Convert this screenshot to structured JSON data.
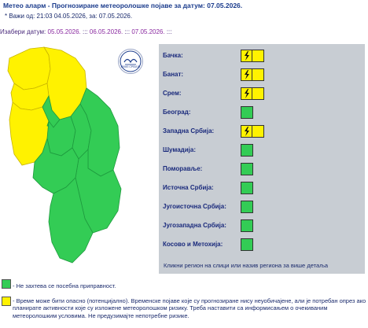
{
  "header": {
    "title": "Метео аларм - Прогнозиране метеоролошке појаве за датум:  07.05.2026.",
    "validity": "* Важи од: 21:03 04.05.2026, за: 07.05.2026."
  },
  "date_selector": {
    "label": "Изабери датум:",
    "dates": [
      "05.05.2026.",
      "06.05.2026.",
      "07.05.2026."
    ],
    "separator": ":::"
  },
  "emblem": {
    "text": "РХМЗ СРБИЈЕ"
  },
  "regions": [
    {
      "name": "Бачка:",
      "level": "yellow",
      "icon": "thunderstorm-icon"
    },
    {
      "name": "Банат:",
      "level": "yellow",
      "icon": "thunderstorm-icon"
    },
    {
      "name": "Срем:",
      "level": "yellow",
      "icon": "thunderstorm-icon"
    },
    {
      "name": "Београд:",
      "level": "green",
      "icon": ""
    },
    {
      "name": "Западна Србија:",
      "level": "yellow",
      "icon": "thunderstorm-icon"
    },
    {
      "name": "Шумадија:",
      "level": "green",
      "icon": ""
    },
    {
      "name": "Поморавље:",
      "level": "green",
      "icon": ""
    },
    {
      "name": "Источна Србија:",
      "level": "green",
      "icon": ""
    },
    {
      "name": "Југоисточна Србија:",
      "level": "green",
      "icon": ""
    },
    {
      "name": "Југозападна Србија:",
      "level": "green",
      "icon": ""
    },
    {
      "name": "Косово и Метохија:",
      "level": "green",
      "icon": ""
    }
  ],
  "panel_hint": "Кликни регион на слици или назив региона за више детаља",
  "legend": {
    "green_text": "- Не захтева се посебна приправност.",
    "yellow_text": "- Време може бити опасно (потенцијално). Временске појаве које су прогнозиране нису неуобичајене, али је потребан опрез ако планирате активности које су изложене метеоролошком ризику. Треба наставити са информисањем о очекиваним метеоролошким условима. Не предузимајте непотребне ризике."
  },
  "colors": {
    "green": "#33cc55",
    "yellow": "#fff200",
    "panel_bg": "#c8cdd3",
    "title": "#1a3b8c"
  }
}
